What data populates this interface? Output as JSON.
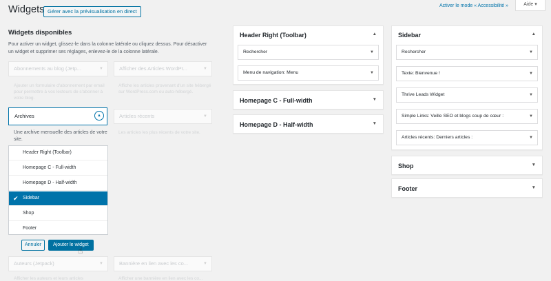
{
  "header": {
    "title": "Widgets",
    "live_preview_button": "Gérer avec la prévisualisation en direct",
    "accessibility_link": "Activer le mode « Accessibilité »",
    "help_tab": "Aide ▾"
  },
  "available": {
    "title": "Widgets disponibles",
    "description": "Pour activer un widget, glissez-le dans la colonne latérale ou cliquez dessus. Pour désactiver un widget et supprimer ses réglages, enlevez-le de la colonne latérale.",
    "widgets": [
      {
        "title": "Abonnements au blog (Jetp...",
        "desc": "Ajouter un formulaire d'abonnement par email pour permettre à vos lecteurs de s'abonner à votre blog."
      },
      {
        "title": "Afficher des Articles WordPr...",
        "desc": "Affiche les articles provenant d'un site hébergé sur WordPress.com ou auto-hébergé."
      },
      {
        "title": "Articles récents",
        "desc": "Les articles les plus récents de votre site."
      },
      {
        "title": "Auteurs (Jetpack)",
        "desc": "Afficher les auteurs et leurs articles"
      },
      {
        "title": "Bannière en lien avec les co...",
        "desc": "Afficher une bannière en lien avec les co..."
      }
    ],
    "expanded": {
      "title": "Archives",
      "desc": "Une archive mensuelle des articles de votre site.",
      "areas": [
        "Header Right (Toolbar)",
        "Homepage C - Full-width",
        "Homepage D - Half-width",
        "Sidebar",
        "Shop",
        "Footer"
      ],
      "selected_area": "Sidebar",
      "cancel_label": "Annuler",
      "add_label": "Ajouter le widget"
    }
  },
  "areas_col1": [
    {
      "title": "Header Right (Toolbar)",
      "widgets": [
        "Rechercher",
        "Menu de navigation: Menu"
      ]
    },
    {
      "title": "Homepage C - Full-width",
      "widgets": []
    },
    {
      "title": "Homepage D - Half-width",
      "widgets": []
    }
  ],
  "areas_col2": [
    {
      "title": "Sidebar",
      "widgets": [
        "Rechercher",
        "Texte: Bienvenue !",
        "Thrive Leads Widget",
        "Simple Links: Veille SEO et blogs coup de cœur :",
        "Articles récents: Derniers articles :"
      ]
    },
    {
      "title": "Shop",
      "widgets": []
    },
    {
      "title": "Footer",
      "widgets": []
    }
  ],
  "colors": {
    "accent": "#0073aa",
    "background": "#f1f1f1"
  }
}
